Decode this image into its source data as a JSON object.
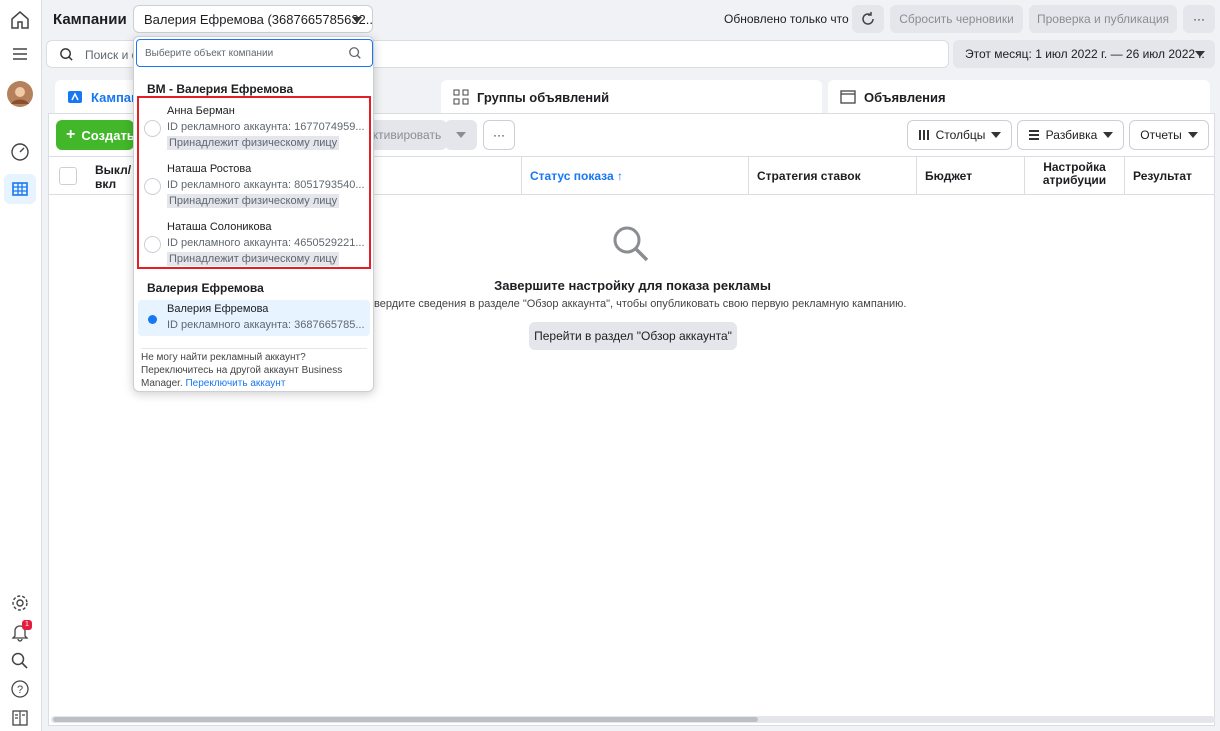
{
  "header": {
    "title": "Кампании",
    "account_selector": "Валерия Ефремова (3687665785632...",
    "updated": "Обновлено только что",
    "reset_drafts": "Сбросить черновики",
    "review_publish": "Проверка и публикация",
    "more": "···"
  },
  "search": {
    "placeholder": "Поиск и ф"
  },
  "date_range": "Этот месяц: 1 июл 2022 г. — 26 июл 2022 г.",
  "tabs": [
    {
      "label": "Кампании"
    },
    {
      "label": "Группы объявлений"
    },
    {
      "label": "Объявления"
    }
  ],
  "toolbar": {
    "create": "Создать",
    "activate": "ктивировать",
    "more": "···",
    "columns": "Столбцы",
    "breakdown": "Разбивка",
    "reports": "Отчеты"
  },
  "table": {
    "headers": {
      "toggle": "Выкл/\nвкл",
      "status": "Статус показа",
      "strategy": "Стратегия ставок",
      "budget": "Бюджет",
      "attribution": "Настройка атрибуции",
      "result": "Результат"
    }
  },
  "empty": {
    "title": "Завершите настройку для показа рекламы",
    "desc": "твердите сведения в разделе \"Обзор аккаунта\", чтобы опубликовать свою первую рекламную кампанию.",
    "button": "Перейти в раздел \"Обзор аккаунта\""
  },
  "dropdown": {
    "search_placeholder": "Выберите объект компании",
    "group1": "BM - Валерия Ефремова",
    "items": [
      {
        "name": "Анна Берман",
        "id": "ID рекламного аккаунта: 1677074959...",
        "badge": "Принадлежит физическому лицу"
      },
      {
        "name": "Наташа Ростова",
        "id": "ID рекламного аккаунта: 8051793540...",
        "badge": "Принадлежит физическому лицу"
      },
      {
        "name": "Наташа Солоникова",
        "id": "ID рекламного аккаунта: 4650529221...",
        "badge": "Принадлежит физическому лицу"
      }
    ],
    "group2": "Валерия Ефремова",
    "selected": {
      "name": "Валерия Ефремова",
      "id": "ID рекламного аккаунта: 3687665785..."
    },
    "footer_text": "Не могу найти рекламный аккаунт? Переключитесь на другой аккаунт Business Manager.",
    "footer_link": "Переключить аккаунт"
  },
  "notifications": {
    "count": "1"
  },
  "colors": {
    "accent": "#1877f2",
    "create": "#42b72a",
    "highlight": "#e41e26"
  }
}
